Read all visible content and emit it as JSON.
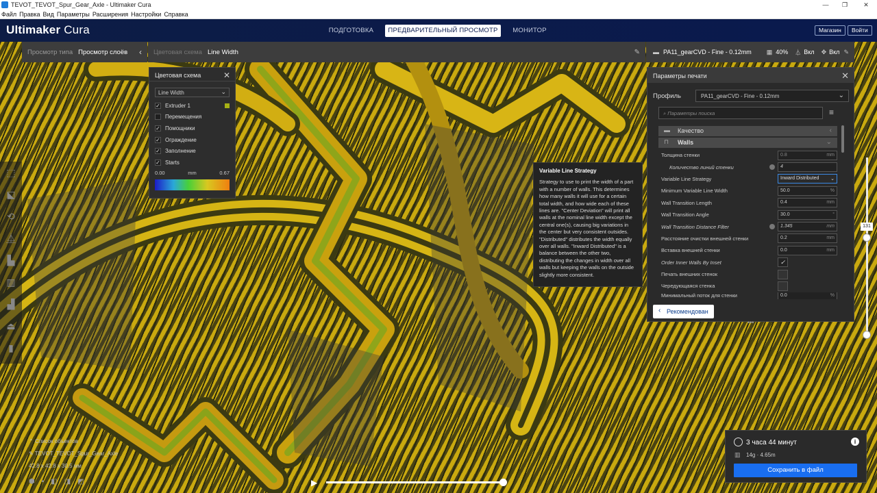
{
  "window": {
    "title": "TEVOT_TEVOT_Spur_Gear_Axle - Ultimaker Cura",
    "controls": {
      "minimize": "—",
      "maximize": "❐",
      "close": "✕"
    }
  },
  "menu": [
    "Файл",
    "Правка",
    "Вид",
    "Параметры",
    "Расширения",
    "Настройки",
    "Справка"
  ],
  "header": {
    "logo_bold": "Ultimaker",
    "logo_light": " Cura",
    "tabs": [
      {
        "label": "ПОДГОТОВКА",
        "active": false
      },
      {
        "label": "ПРЕДВАРИТЕЛЬНЫЙ ПРОСМОТР",
        "active": true
      },
      {
        "label": "МОНИТОР",
        "active": false
      }
    ],
    "marketplace": "Магазин",
    "login": "Войти"
  },
  "viewbar": {
    "label": "Просмотр типа",
    "value": "Просмотр слоёв"
  },
  "colorbar": {
    "label": "Цветовая схема",
    "value": "Line Width"
  },
  "profilebar": {
    "profile": "PA11_gearCVD - Fine - 0.12mm",
    "infill": "40%",
    "support": "Вкл",
    "adhesion": "Вкл"
  },
  "color_scheme_panel": {
    "title": "Цветовая схема",
    "selected": "Line Width",
    "items": [
      {
        "label": "Extruder 1",
        "checked": true
      },
      {
        "label": "Перемещения",
        "checked": false
      },
      {
        "label": "Помощники",
        "checked": true
      },
      {
        "label": "Ограждение",
        "checked": true
      },
      {
        "label": "Заполнение",
        "checked": true
      },
      {
        "label": "Starts",
        "checked": true
      }
    ],
    "min": "0.00",
    "unit": "mm",
    "max": "0.67"
  },
  "tooltip": {
    "title": "Variable Line Strategy",
    "body": "Strategy to use to print the width of a part with a number of walls. This determines how many walls it will use for a certain total width, and how wide each of these lines are. \"Center Deviation\" will print all walls at the nominal line width except the central one(s), causing big variations in the center but very consistent outsides. \"Distributed\" distributes the width equally over all walls. \"Inward Distributed\" is a balance between the other two, distributing the changes in width over all walls but keeping the walls on the outside slightly more consistent."
  },
  "print_settings": {
    "title": "Параметры печати",
    "profile_label": "Профиль",
    "profile_value": "PA11_gearCVD - Fine - 0.12mm",
    "search_placeholder": "Параметры поиска",
    "categories": [
      {
        "label": "Качество",
        "chevron": "‹"
      },
      {
        "label": "Walls",
        "chevron": "⌄"
      }
    ],
    "rows": [
      {
        "label": "Толщина стенки",
        "value": "0.8",
        "unit": "mm",
        "style": "dim"
      },
      {
        "label": "Количество линий стенки",
        "value": "4",
        "unit": "",
        "italic": true,
        "indent": true,
        "icon": true
      },
      {
        "label": "Variable Line Strategy",
        "value": "Inward Distributed",
        "unit": "⌄",
        "style": "hi"
      },
      {
        "label": "Minimum Variable Line Width",
        "value": "50.0",
        "unit": "%"
      },
      {
        "label": "Wall Transition Length",
        "value": "0.4",
        "unit": "mm"
      },
      {
        "label": "Wall Transition Angle",
        "value": "30.0",
        "unit": "°"
      },
      {
        "label": "Wall Transition Distance Filter",
        "value": "1.345",
        "unit": "mm",
        "italic": true,
        "icon": true
      },
      {
        "label": "Расстояние очистки внешней стенки",
        "value": "0.2",
        "unit": "mm"
      },
      {
        "label": "Вставка внешней стенки",
        "value": "0.0",
        "unit": "mm"
      },
      {
        "label": "Order Inner Walls By Inset",
        "value": "✓",
        "unit": "",
        "italic": true,
        "style": "chk"
      },
      {
        "label": "Печать внешних стенок",
        "value": "",
        "unit": "",
        "style": "empty"
      },
      {
        "label": "Чередующаяся стенка",
        "value": "",
        "unit": "",
        "style": "empty"
      },
      {
        "label": "Минимальный поток для стенки",
        "value": "0.0",
        "unit": "%"
      }
    ],
    "recommended": "Рекомендован"
  },
  "layer_slider": {
    "value": "131"
  },
  "object_list": {
    "header": "Список объектов",
    "name": "TEVOT_TEVOT_Spur_Gear_Axle",
    "dimensions": "42.8 x 42.8 x 30.5 мм"
  },
  "estimate": {
    "time": "3 часа 44 минут",
    "material": "14g · 4.65m",
    "save": "Сохранить в файл"
  }
}
